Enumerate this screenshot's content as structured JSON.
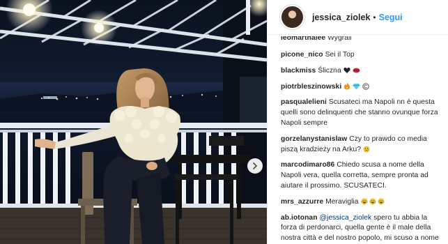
{
  "post": {
    "username": "jessica_ziolek",
    "separator": "•",
    "follow_label": "Segui"
  },
  "icons": {
    "next": "chevron-right-icon",
    "heart": "heart-icon",
    "lips": "lips-icon",
    "fire": "fire-icon",
    "diamond": "gem-icon",
    "copyright": "copyright-icon",
    "sad": "sad-face-icon",
    "crying_laugh": "laughing-face-icon",
    "hands": "praying-hands-icon"
  },
  "comments": [
    {
      "user": "leomarthalee",
      "text": "Wygrali"
    },
    {
      "user": "picone_nico",
      "text": "Sei il Top"
    },
    {
      "user": "blackmiss",
      "text": "Śliczna"
    },
    {
      "user": "piotrbleszinowski",
      "text": ""
    },
    {
      "user": "pasqualelieni",
      "text": "Scusateci ma Napoli nn è questa quelli sono delinquenti che stanno ovunque forza Napoli sempre"
    },
    {
      "user": "gorzelanystanislaw",
      "text": "Czy to prawdo co media piszą kradzieży na Arku?"
    },
    {
      "user": "marcodimaro86",
      "text": "Chiedo scusa a nome della Napoli vera, quella corretta, sempre pronta ad aiutare il prossimo. SCUSATECI."
    },
    {
      "user": "mrs_azzurre",
      "text": "Meraviglia"
    },
    {
      "user": "ab.iotonan",
      "mention": "@jessica_ziolek",
      "text": "spero tu abbia la forza di perdonarci, quella gente è il male della nostra città e del nostro popolo, mi scuso a nome di tutti i napoletani che ti amano veramente"
    }
  ]
}
